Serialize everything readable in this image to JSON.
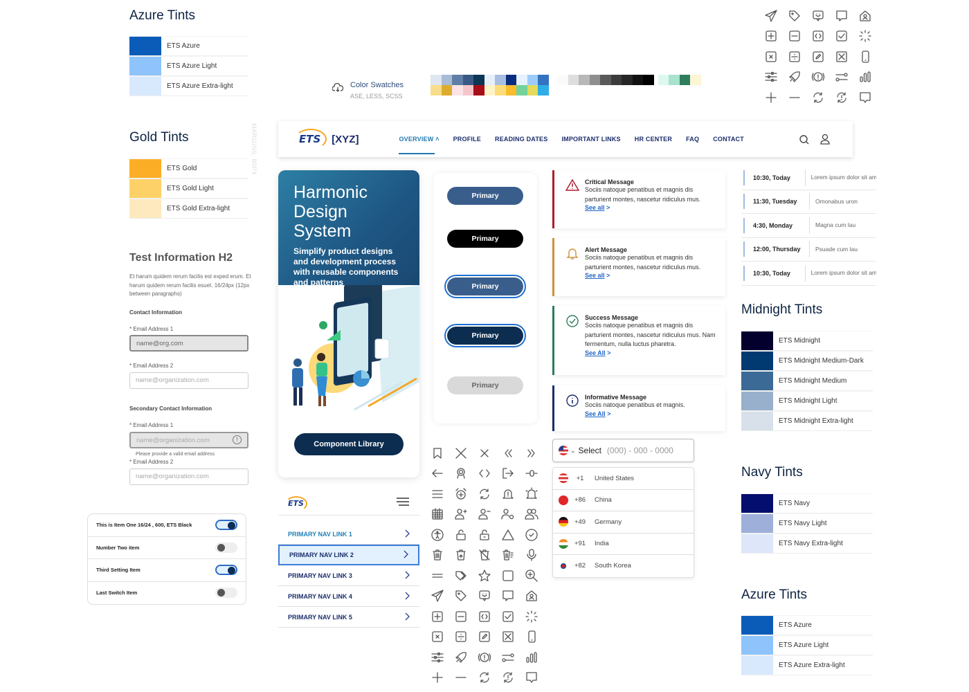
{
  "azure_tints_top": {
    "title": "Azure Tints",
    "rows": [
      {
        "label": "ETS Azure",
        "color": "#0b5cb8"
      },
      {
        "label": "ETS Azure Light",
        "color": "#8ec4fb"
      },
      {
        "label": "ETS Azure Extra-light",
        "color": "#d8e9fd"
      }
    ]
  },
  "gold_tints": {
    "title": "Gold Tints",
    "rows": [
      {
        "label": "ETS Gold",
        "color": "#fcae27"
      },
      {
        "label": "ETS Gold Light",
        "color": "#fdd168"
      },
      {
        "label": "ETS Gold Extra-light",
        "color": "#fde9bd"
      }
    ]
  },
  "margins_note": "MARGINS: 80PX",
  "form": {
    "heading": "Test Information H2",
    "paragraph": "Et harum quidem rerum facilis est exped erum. Et harum quidem rerum facilis esuet. 16/24px (12px between paragraphs)",
    "contact_heading": "Contact Information",
    "email1_label": "* Email Address 1",
    "email1_value": "name@org.com",
    "email2_label": "* Email Address 2",
    "email2_placeholder": "name@organization.com",
    "secondary_heading": "Secondary Contact Information",
    "sec_email1_label": "* Email Address 1",
    "sec_email1_placeholder": "name@organization.com",
    "sec_email1_error": "Please provide a valid email address",
    "sec_email2_label": "* Email Address 2",
    "sec_email2_placeholder": "name@organization.com"
  },
  "switches": [
    {
      "label": "This is Item One  16/24 , 600, ETS Black",
      "on": true
    },
    {
      "label": "Number Two item",
      "on": false
    },
    {
      "label": "Third Setting Item",
      "on": true
    },
    {
      "label": "Last Switch Item",
      "on": false
    }
  ],
  "color_swatches": {
    "title": "Color Swatches",
    "subtitle": "ASE, LESS, SCSS",
    "row1": [
      "#dfe6f1",
      "#a8bcd6",
      "#5f7fa6",
      "#3a5a85",
      "#0d3554",
      "#e6f0fb",
      "#a9bfe2",
      "#0c2d7f",
      "#e6f2fd",
      "#9dcbfa",
      "#3472c2"
    ],
    "row2": [
      "#f8de8a",
      "#dcac2e",
      "#fde3e6",
      "#f4c5cb",
      "#a80d1a",
      "#fff3c8",
      "#fddc7a",
      "#fbbc2c",
      "#74d39b",
      "#e5da5c",
      "#2eaee8"
    ],
    "greys": [
      "#fafafa",
      "#dedede",
      "#b8b8b8",
      "#8f8f8f",
      "#5a5a5a",
      "#3c3c3c",
      "#262626",
      "#111111",
      "#000000"
    ],
    "extras": [
      "#def8f0",
      "#a9e2cd",
      "#2e7e5e",
      "#fdf5d4"
    ]
  },
  "header": {
    "logo": "ETS",
    "product": "[XYZ]",
    "nav": [
      "OVERVIEW",
      "PROFILE",
      "READING DATES",
      "IMPORTANT LINKS",
      "HR CENTER",
      "FAQ",
      "CONTACT"
    ],
    "active": "OVERVIEW"
  },
  "hero": {
    "title_line1": "Harmonic",
    "title_line2": "Design System",
    "subtitle": "Simplify product designs and development process with reusable components and patterns",
    "cta": "Component Library"
  },
  "buttons": [
    {
      "label": "Primary",
      "variant": "default"
    },
    {
      "label": "Primary",
      "variant": "black"
    },
    {
      "label": "Primary",
      "variant": "focus"
    },
    {
      "label": "Primary",
      "variant": "dark-focus"
    },
    {
      "label": "Primary",
      "variant": "disabled"
    }
  ],
  "alerts": [
    {
      "title": "Critical Message",
      "body": "Sociis natoque penatibus et magnis dis parturient montes, nascetur ridiculus mus.",
      "link": "See all",
      "color": "#b01c2e",
      "icon": "warning-icon"
    },
    {
      "title": "Alert Message",
      "body": "Sociis natoque penatibus et magnis dis parturient montes, nascetur ridiculus mus.",
      "link": "See all",
      "color": "#d0923a",
      "icon": "bell-icon"
    },
    {
      "title": "Success Message",
      "body": "Sociis natoque penatibus et magnis dis parturient montes, nascetur ridiculus mus. Nam fermentum, nulla luctus pharetra.",
      "link": "See All",
      "color": "#2e7d5b",
      "icon": "check-circle-icon"
    },
    {
      "title": "Informative Message",
      "body": "Sociis natoque penatibus et magnis.",
      "link": "See All",
      "color": "#1b2d6b",
      "icon": "info-icon"
    }
  ],
  "schedule": [
    {
      "time": "10:30, Today",
      "desc": "Lorem ipsum dolor sit amet"
    },
    {
      "time": "11:30, Tuesday",
      "desc": "Omonabus uron"
    },
    {
      "time": "4:30, Monday",
      "desc": "Magna cum lau"
    },
    {
      "time": "12:00, Thursday",
      "desc": "Psuade cum lau"
    },
    {
      "time": "10:30, Today",
      "desc": "Lorem ipsum dolor sit amet"
    }
  ],
  "midnight_tints": {
    "title": "Midnight Tints",
    "rows": [
      {
        "label": "ETS Midnight",
        "color": "#03002e"
      },
      {
        "label": "ETS Midnight Medium-Dark",
        "color": "#013a71"
      },
      {
        "label": "ETS Midnight Medium",
        "color": "#3b6a96"
      },
      {
        "label": "ETS Midnight Light",
        "color": "#99b0cc"
      },
      {
        "label": "ETS Midnight Extra-light",
        "color": "#d8e0ea"
      }
    ]
  },
  "navy_tints": {
    "title": "Navy Tints",
    "rows": [
      {
        "label": "ETS Navy",
        "color": "#030e6e"
      },
      {
        "label": "ETS Navy Light",
        "color": "#9eb0da"
      },
      {
        "label": "ETS Navy Extra-light",
        "color": "#dde7f9"
      }
    ]
  },
  "azure_tints_bottom": {
    "title": "Azure Tints",
    "rows": [
      {
        "label": "ETS Azure",
        "color": "#0b5cb8"
      },
      {
        "label": "ETS Azure Light",
        "color": "#8ec4fb"
      },
      {
        "label": "ETS Azure Extra-light",
        "color": "#d8e9fd"
      }
    ]
  },
  "phone": {
    "select_label": "Select",
    "placeholder": "(000) - 000 - 0000",
    "countries": [
      {
        "code": "+1",
        "name": "United States",
        "flag": "us"
      },
      {
        "code": "+86",
        "name": "China",
        "flag": "cn"
      },
      {
        "code": "+49",
        "name": "Germany",
        "flag": "de"
      },
      {
        "code": "+91",
        "name": "India",
        "flag": "in"
      },
      {
        "code": "+82",
        "name": "South Korea",
        "flag": "kr"
      }
    ]
  },
  "mobile_nav": {
    "logo": "ETS",
    "links": [
      "PRIMARY NAV LINK 1",
      "PRIMARY NAV LINK 2",
      "PRIMARY NAV LINK 3",
      "PRIMARY NAV LINK 4",
      "PRIMARY NAV LINK 5"
    ],
    "selected_index": 1
  },
  "icons_top_right": [
    "send",
    "tag",
    "chat-smile",
    "chat",
    "home-user",
    "plus-square",
    "minus-square",
    "code-square",
    "check-square",
    "loading",
    "x-square",
    "divide-square",
    "edit-square",
    "close-square",
    "mobile",
    "sliders",
    "rocket",
    "alert-circle-paren",
    "toggle-line",
    "bar-chart",
    "plus",
    "minus",
    "refresh",
    "sync-alert",
    "message"
  ],
  "icons_middle": [
    "bookmark",
    "close-large",
    "close",
    "chevrons-left",
    "chevrons-right",
    "arrow-left",
    "award",
    "code",
    "logout",
    "slider-handle",
    "menu",
    "alarm-add",
    "refresh",
    "bell-alert",
    "bell-ring",
    "calendar",
    "user-add",
    "user-remove",
    "user-settings",
    "users",
    "accessibility",
    "unlock",
    "unlock-alt",
    "triangle",
    "check-circle",
    "trash",
    "trash-restore",
    "trash-off",
    "trash-list",
    "microphone",
    "equals",
    "tags",
    "star",
    "square",
    "zoom-in",
    "send",
    "tag",
    "chat-smile",
    "chat",
    "home-user",
    "plus-square",
    "minus-square",
    "code-square",
    "check-square",
    "loading",
    "x-square",
    "divide-square",
    "edit-square",
    "close-square",
    "mobile",
    "sliders",
    "rocket",
    "alert-circle-paren",
    "toggle-line",
    "bar-chart",
    "plus",
    "minus",
    "refresh",
    "sync-alert",
    "message"
  ]
}
